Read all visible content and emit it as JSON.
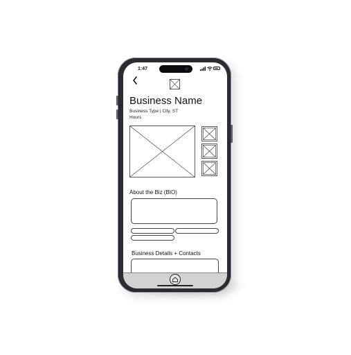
{
  "status_bar": {
    "time": "1:47",
    "signal_icon": "signal-icon",
    "wifi_icon": "wifi-icon",
    "battery_icon": "battery-icon",
    "battery_level": 0.8
  },
  "header": {
    "back_icon": "chevron-left-icon",
    "logo_icon": "image-placeholder-icon"
  },
  "business": {
    "name": "Business Name",
    "subtitle": "Business Type | City, ST",
    "hours": "Hours"
  },
  "gallery": {
    "main_image_icon": "image-placeholder-icon",
    "thumbnail_icons": [
      "image-placeholder-icon",
      "image-placeholder-icon",
      "image-placeholder-icon"
    ]
  },
  "about": {
    "label": "About the Biz (BIO)",
    "bio_text": "",
    "tags": [
      "",
      "",
      ""
    ]
  },
  "details": {
    "label": "Business Details + Contacts",
    "content": ""
  },
  "nav": {
    "home_icon": "home-icon"
  },
  "colors": {
    "phone_frame": "#2b2d33",
    "screen_bg": "#ffffff",
    "wireframe_line": "#444444",
    "bottom_bar": "#d2d2d2"
  }
}
